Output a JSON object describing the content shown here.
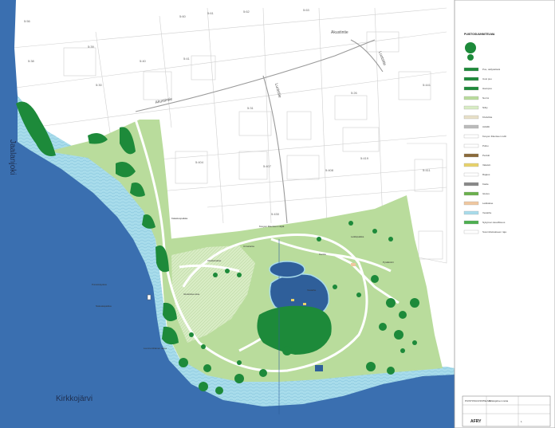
{
  "water_labels": {
    "river": "Jaalanjoki",
    "lake": "Kirkkojärvi"
  },
  "street_labels": [
    "Akustintie",
    "Akustintie",
    "Luotsitie",
    "Luotsitie"
  ],
  "block_numbers": [
    "5:56",
    "5:60",
    "5:61",
    "5:62",
    "5:63",
    "5:38",
    "5:39",
    "5:40",
    "5:41",
    "5:30",
    "5:31",
    "5:26",
    "5:441",
    "5:411",
    "5:404",
    "5:407",
    "5:408",
    "5:430",
    "5:419"
  ],
  "map_notes": [
    "Kalastuspaikka",
    "Kevyen liikenteen väylä",
    "Uimaranta",
    "Oleskelualue",
    "Kentta",
    "Leikkipaikka",
    "Puistokäytävä",
    "Näkoalapaikka",
    "Istutettava alue",
    "Luonnontilainen ranta",
    "Pysäköinti",
    "Vesiaihe"
  ],
  "legend": {
    "title": "PUISTOSUUNNITELMA",
    "items": [
      "Puu, säilytettävä",
      "Uusi puu",
      "Havupuu",
      "Nurmi",
      "Niitty",
      "Kivituhka",
      "Asfaltti",
      "Kevyen liikenteen reitti",
      "Polku",
      "Penkki",
      "Valaisin",
      "Rajaus",
      "Kaide",
      "Istutus",
      "Leikkialue",
      "Vesiaihe",
      "Nykyinen kasvillisuus",
      "Suunnittelualueen raja"
    ]
  },
  "title_block": {
    "project": "PUISTOSUUNNITELMA",
    "place": "Kirkkojärven ranta",
    "drawing_no": "1",
    "company": "AFRY"
  },
  "colors": {
    "lake_deep": "#3a6fb0",
    "lake_shallow": "#a8dceb",
    "grass": "#b9dc9c",
    "grass_light": "#d8ecc4",
    "trees": "#1d8a3a",
    "paths": "#ffffff",
    "pond": "#2f5f9a"
  }
}
